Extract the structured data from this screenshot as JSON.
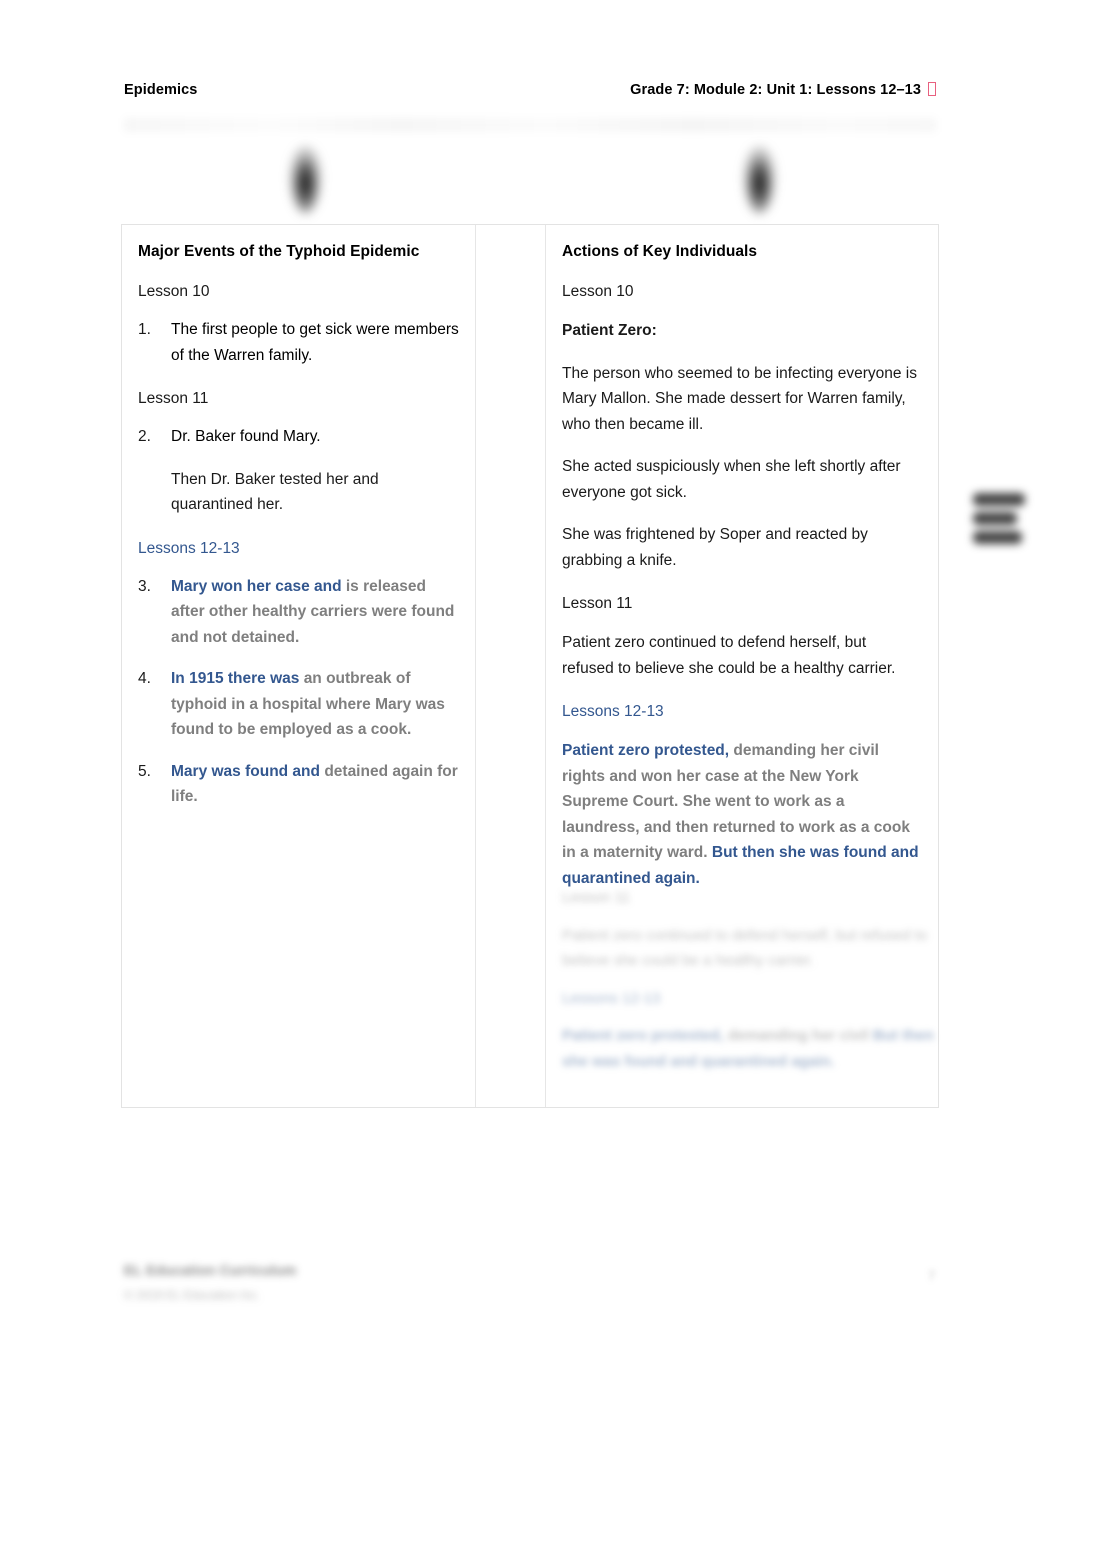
{
  "header": {
    "left": "Epidemics",
    "right": "Grade 7: Module 2: Unit 1: Lessons 12–13",
    "missing_glyph_name": "missing-character-box"
  },
  "colors": {
    "revision_blue": "#33578F",
    "prior_gray": "#7F7F7F",
    "body_black": "#1A1A1A",
    "table_border": "#E3E3E3",
    "missing_glyph_pink": "#E8607F"
  },
  "table": {
    "left_column": {
      "title": "Major Events of the Typhoid Epidemic",
      "blocks": [
        {
          "type": "lesson_label",
          "text": "Lesson 10",
          "style": "black"
        },
        {
          "type": "numbered",
          "number": "1.",
          "runs": [
            {
              "text": "The first people to get sick were members of the Warren family.",
              "style": "black"
            }
          ]
        },
        {
          "type": "lesson_label",
          "text": "Lesson 11",
          "style": "black"
        },
        {
          "type": "numbered",
          "number": "2.",
          "runs": [
            {
              "text": "Dr. Baker found Mary.",
              "style": "black"
            }
          ],
          "sub": "Then Dr. Baker tested her and quarantined her."
        },
        {
          "type": "lesson_label",
          "text": "Lessons 12-13",
          "style": "blue"
        },
        {
          "type": "numbered",
          "number": "3.",
          "runs": [
            {
              "text": "Mary won her case and ",
              "style": "blue"
            },
            {
              "text": "is released after other healthy carriers were found and not detained.",
              "style": "gray"
            }
          ]
        },
        {
          "type": "numbered",
          "number": "4.",
          "runs": [
            {
              "text": "In 1915 there was ",
              "style": "blue"
            },
            {
              "text": "an outbreak of typhoid in a hospital where Mary was found to be employed as a cook.",
              "style": "gray"
            }
          ]
        },
        {
          "type": "numbered",
          "number": "5.",
          "runs": [
            {
              "text": "Mary was found and ",
              "style": "blue"
            },
            {
              "text": "detained again for life.",
              "style": "gray"
            }
          ]
        }
      ]
    },
    "middle_column": {
      "content": ""
    },
    "right_column": {
      "title": "Actions of Key Individuals",
      "blocks": [
        {
          "type": "lesson_label",
          "text": "Lesson 10",
          "style": "black"
        },
        {
          "type": "paragraph",
          "bold": true,
          "runs": [
            {
              "text": "Patient Zero:",
              "style": "black"
            }
          ]
        },
        {
          "type": "paragraph",
          "bold": false,
          "runs": [
            {
              "text": "The person who seemed to be infecting everyone is Mary Mallon. She made dessert for Warren family, who then became ill.",
              "style": "black"
            }
          ]
        },
        {
          "type": "paragraph",
          "bold": false,
          "runs": [
            {
              "text": "She acted suspiciously when she left shortly after everyone got sick.",
              "style": "black"
            }
          ]
        },
        {
          "type": "paragraph",
          "bold": false,
          "runs": [
            {
              "text": "She was frightened by Soper and reacted by grabbing a knife.",
              "style": "black"
            }
          ]
        },
        {
          "type": "lesson_label",
          "text": "Lesson 11",
          "style": "black"
        },
        {
          "type": "paragraph",
          "bold": false,
          "runs": [
            {
              "text": "Patient zero continued to defend herself, but refused to believe she could be a healthy carrier.",
              "style": "black"
            }
          ]
        },
        {
          "type": "lesson_label",
          "text": "Lessons 12-13",
          "style": "blue"
        },
        {
          "type": "paragraph",
          "bold": false,
          "runs": [
            {
              "text": "Patient zero protested, ",
              "style": "blue"
            },
            {
              "text": "demanding her civil rights and won her case at the New York Supreme Court. She went to work as a laundress, and then returned to work as a cook in a maternity ward. ",
              "style": "gray"
            },
            {
              "text": "But then she was found and quarantined again.",
              "style": "blue"
            }
          ]
        }
      ]
    }
  },
  "ghost_overlay": {
    "note": "faded duplicate of right-column content bleeding through below the table text",
    "lesson_label": "Lesson 11",
    "paragraph": "Patient zero continued to defend herself, but refused to believe she could be a healthy carrier.",
    "lessons_label": "Lessons 12-13",
    "revision_line_blue_1": "Patient zero protested,",
    "revision_line_gray": "demanding her civil",
    "revision_line_blue_2": "But then she was found and quarantined again."
  },
  "footer": {
    "line1": "EL Education Curriculum",
    "line2": "© 2019 EL Education Inc.",
    "page_number": "7"
  }
}
